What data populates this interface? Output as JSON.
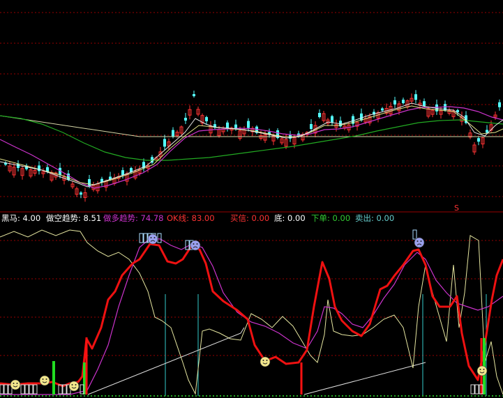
{
  "chart_data": [
    {
      "type": "candlestick",
      "panel": "price",
      "moving_averages": [
        "white",
        "yellow",
        "magenta",
        "green"
      ],
      "grid": "dashed-red-horizontal",
      "annotation_marker": "S"
    },
    {
      "type": "line",
      "panel": "indicator",
      "series": [
        {
          "name": "黑马",
          "value": 4.0,
          "color": "#ffffff"
        },
        {
          "name": "做空趋势",
          "value": 8.51,
          "color": "#ffffff"
        },
        {
          "name": "做多趋势",
          "value": 74.78,
          "color": "#cc33cc"
        },
        {
          "name": "OK线",
          "value": 83.0,
          "color": "#ff3333"
        },
        {
          "name": "买信",
          "value": 0.0,
          "color": "#ff3333"
        },
        {
          "name": "底",
          "value": 0.0,
          "color": "#ffffff"
        },
        {
          "name": "下单",
          "value": 0.0,
          "color": "#33cc33"
        },
        {
          "name": "卖出",
          "value": 0.0,
          "color": "#66cccc"
        }
      ]
    }
  ],
  "status": {
    "heima": "黑马: 4.00",
    "zuokong": "做空趋势: 8.51",
    "zuoduo": "做多趋势: 74.78",
    "ok": "OK线: 83.00",
    "maixin": "买信: 0.00",
    "di": "底: 0.00",
    "xiadan": "下单: 0.00",
    "maichu": "卖出: 0.00"
  },
  "marker_text": "S",
  "colors": {
    "up": "#ff3333",
    "down": "#54ffff",
    "grid": "#990000",
    "ma_white": "#e6e6e6",
    "ma_yellow": "#e6e68a",
    "ma_magenta": "#cc33cc",
    "ma_green": "#22aa22",
    "ok_line": "#ee1111",
    "signal_green": "#22dd22",
    "signal_cyan": "#33cccc"
  }
}
